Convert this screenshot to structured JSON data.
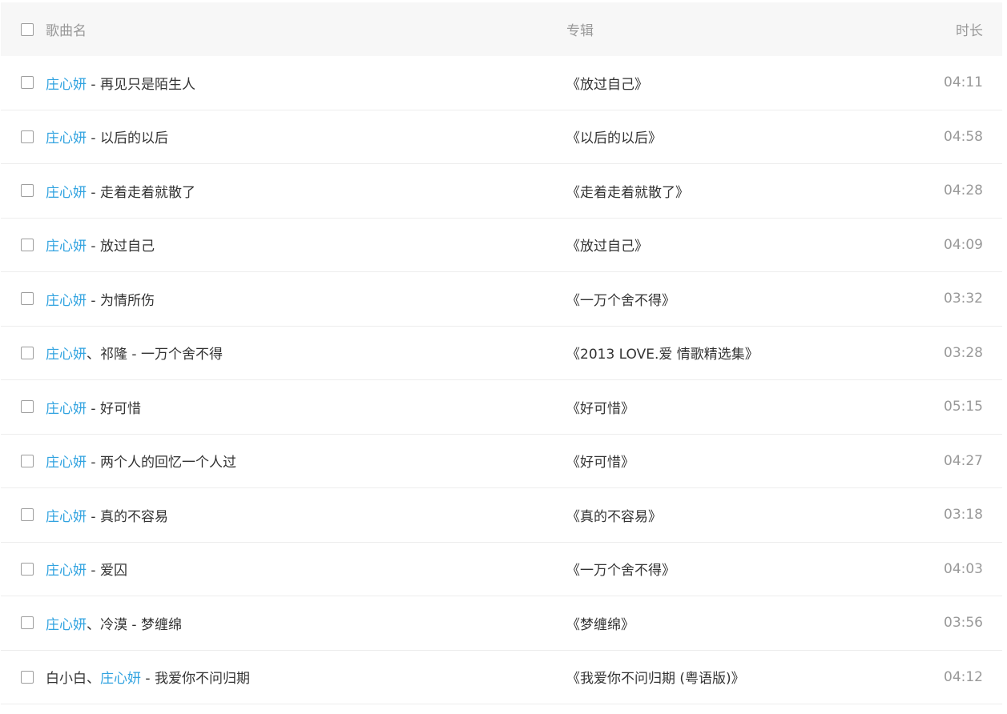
{
  "header": {
    "title_label": "歌曲名",
    "album_label": "专辑",
    "duration_label": "时长"
  },
  "colors": {
    "artist_link": "#31a3e0",
    "text": "#333333",
    "muted": "#999999",
    "header_bg": "#f7f7f7"
  },
  "icons": {
    "checkbox": "checkbox-icon"
  },
  "rows": [
    {
      "artists": [
        {
          "name": "庄心妍",
          "link": true
        }
      ],
      "separator": "",
      "dash": " - ",
      "song": "再见只是陌生人",
      "album": "《放过自己》",
      "duration": "04:11"
    },
    {
      "artists": [
        {
          "name": "庄心妍",
          "link": true
        }
      ],
      "separator": "",
      "dash": " - ",
      "song": "以后的以后",
      "album": "《以后的以后》",
      "duration": "04:58"
    },
    {
      "artists": [
        {
          "name": "庄心妍",
          "link": true
        }
      ],
      "separator": "",
      "dash": " - ",
      "song": "走着走着就散了",
      "album": "《走着走着就散了》",
      "duration": "04:28"
    },
    {
      "artists": [
        {
          "name": "庄心妍",
          "link": true
        }
      ],
      "separator": "",
      "dash": " - ",
      "song": "放过自己",
      "album": "《放过自己》",
      "duration": "04:09"
    },
    {
      "artists": [
        {
          "name": "庄心妍",
          "link": true
        }
      ],
      "separator": "",
      "dash": " - ",
      "song": "为情所伤",
      "album": "《一万个舍不得》",
      "duration": "03:32"
    },
    {
      "artists": [
        {
          "name": "庄心妍",
          "link": true
        },
        {
          "name": "祁隆",
          "link": false
        }
      ],
      "separator": "、",
      "dash": " - ",
      "song": "一万个舍不得",
      "album": "《2013 LOVE.爱 情歌精选集》",
      "duration": "03:28"
    },
    {
      "artists": [
        {
          "name": "庄心妍",
          "link": true
        }
      ],
      "separator": "",
      "dash": " - ",
      "song": "好可惜",
      "album": "《好可惜》",
      "duration": "05:15"
    },
    {
      "artists": [
        {
          "name": "庄心妍",
          "link": true
        }
      ],
      "separator": "",
      "dash": " - ",
      "song": "两个人的回忆一个人过",
      "album": "《好可惜》",
      "duration": "04:27"
    },
    {
      "artists": [
        {
          "name": "庄心妍",
          "link": true
        }
      ],
      "separator": "",
      "dash": " - ",
      "song": "真的不容易",
      "album": "《真的不容易》",
      "duration": "03:18"
    },
    {
      "artists": [
        {
          "name": "庄心妍",
          "link": true
        }
      ],
      "separator": "",
      "dash": " - ",
      "song": "爱囚",
      "album": "《一万个舍不得》",
      "duration": "04:03"
    },
    {
      "artists": [
        {
          "name": "庄心妍",
          "link": true
        },
        {
          "name": "冷漠",
          "link": false
        }
      ],
      "separator": "、",
      "dash": " - ",
      "song": "梦缠绵",
      "album": "《梦缠绵》",
      "duration": "03:56"
    },
    {
      "artists": [
        {
          "name": "白小白",
          "link": false
        },
        {
          "name": "庄心妍",
          "link": true
        }
      ],
      "separator": "、",
      "dash": " - ",
      "song": "我爱你不问归期",
      "album": "《我爱你不问归期 (粤语版)》",
      "duration": "04:12"
    }
  ]
}
